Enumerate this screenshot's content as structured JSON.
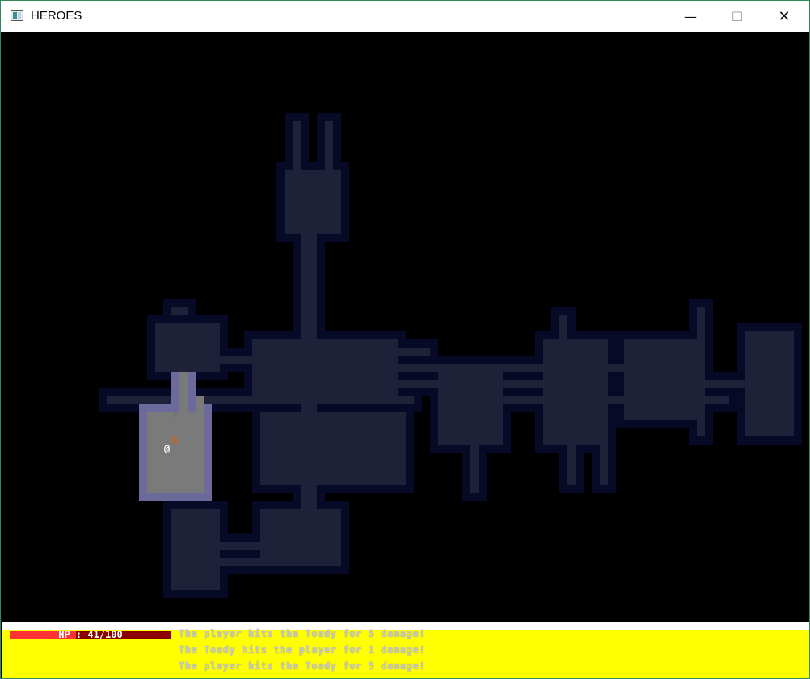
{
  "window": {
    "title": "HEROES",
    "minimize_glyph": "—",
    "maximize_glyph": "☐",
    "close_glyph": "✕"
  },
  "colors": {
    "void": "#000000",
    "dark_wall": "#060a26",
    "dark_floor": "#1e2138",
    "lit_wall": "#6b6a9a",
    "lit_floor": "#7a7a7a",
    "player": "#ffffff",
    "monster": "#c8641e",
    "hud_bg": "#ffff00",
    "hp_full": "#ff3333",
    "hp_empty": "#8b0000"
  },
  "hud": {
    "hp_label": "HP : 41/100",
    "hp_current": 41,
    "hp_max": 100
  },
  "message_log": [
    "The player hits the Toady for 5 damage!",
    "The Toady hits the player for 1 damage!",
    "The player hits the Toady for 5 damage!"
  ],
  "entities": {
    "player_glyph": "@",
    "monster_glyph": "h",
    "item_glyph": "!"
  }
}
